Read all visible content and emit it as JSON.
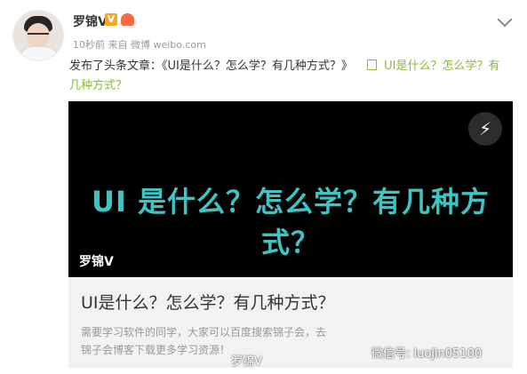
{
  "user": {
    "name": "罗锦V",
    "meta": "10秒前 来自 微博 weibo.com"
  },
  "post": {
    "text": "发布了头条文章：《UI是什么？怎么学？有几种方式？》",
    "link_text": "UI是什么？怎么学？有几种方式？"
  },
  "card": {
    "headline": "UI 是什么？怎么学？有几种方式？",
    "image_watermark": "罗锦V",
    "title": "UI是什么？怎么学？有几种方式？",
    "description": "需要学习软件的同学，大家可以百度搜索锦子会，去锦子会博客下载更多学习资源！"
  },
  "watermarks": {
    "weibo": "罗锦V",
    "wechat": "微信号: luojin05100"
  },
  "colors": {
    "link": "#86bd2d",
    "headline": "#3fc3c3",
    "card_bg": "#f2f2f2"
  },
  "icons": {
    "more": "chevron-down-icon",
    "verified": "vip-v-icon",
    "badge": "member-badge-icon",
    "article": "article-link-icon",
    "flash": "bolt-icon"
  }
}
